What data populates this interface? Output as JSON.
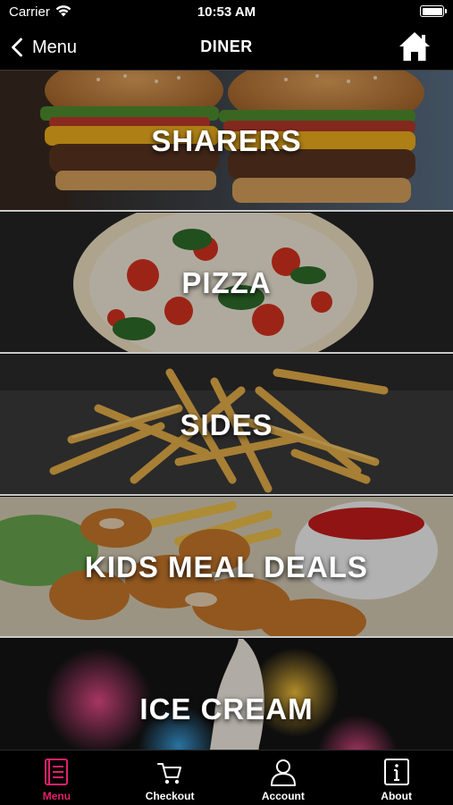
{
  "status_bar": {
    "carrier": "Carrier",
    "time": "10:53 AM"
  },
  "nav": {
    "back_label": "Menu",
    "title": "DINER",
    "home_icon": "home-icon"
  },
  "categories": [
    {
      "label": "SHARERS",
      "image": "burgers"
    },
    {
      "label": "PIZZA",
      "image": "pizza"
    },
    {
      "label": "SIDES",
      "image": "fries"
    },
    {
      "label": "KIDS MEAL DEALS",
      "image": "chicken-nuggets"
    },
    {
      "label": "ICE CREAM",
      "image": "ice-cream-cone"
    }
  ],
  "tabs": [
    {
      "label": "Menu",
      "icon": "menu-book-icon",
      "active": true
    },
    {
      "label": "Checkout",
      "icon": "cart-icon",
      "active": false
    },
    {
      "label": "Account",
      "icon": "user-icon",
      "active": false
    },
    {
      "label": "About",
      "icon": "info-icon",
      "active": false
    }
  ],
  "colors": {
    "accent": "#e0206a",
    "background": "#000000",
    "text": "#ffffff"
  }
}
